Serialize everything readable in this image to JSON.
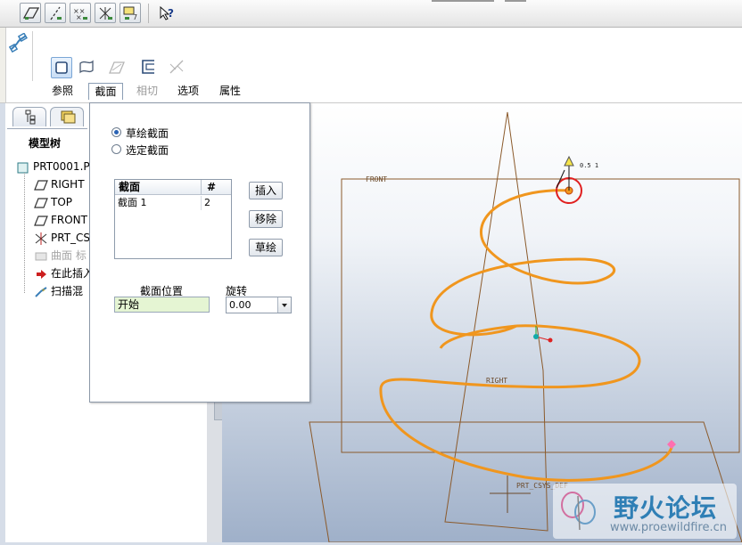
{
  "toolbar": {
    "icons": [
      "datum-plane-display-icon",
      "datum-axis-display-icon",
      "datum-point-display-icon",
      "coordinate-system-display-icon",
      "annotation-display-icon",
      "context-help-icon"
    ]
  },
  "dashboard": {
    "tabs": [
      {
        "label": "参照",
        "state": "normal"
      },
      {
        "label": "截面",
        "state": "active"
      },
      {
        "label": "相切",
        "state": "disabled"
      },
      {
        "label": "选项",
        "state": "normal"
      },
      {
        "label": "属性",
        "state": "normal"
      }
    ]
  },
  "model_tree": {
    "title": "模型树",
    "items": [
      {
        "label": "PRT0001.P",
        "icon": "part-icon",
        "state": "normal"
      },
      {
        "label": "RIGHT",
        "icon": "datum-plane-icon",
        "state": "normal"
      },
      {
        "label": "TOP",
        "icon": "datum-plane-icon",
        "state": "normal"
      },
      {
        "label": "FRONT",
        "icon": "datum-plane-icon",
        "state": "normal"
      },
      {
        "label": "PRT_CS",
        "icon": "coordinate-system-icon",
        "state": "normal"
      },
      {
        "label": "曲面 标",
        "icon": "surface-icon",
        "state": "greyed"
      },
      {
        "label": "在此插入",
        "icon": "insert-here-arrow-icon",
        "state": "normal"
      },
      {
        "label": "扫描混",
        "icon": "swept-blend-icon",
        "state": "normal"
      }
    ]
  },
  "sections_panel": {
    "radio_sketched": "草绘截面",
    "radio_selected": "选定截面",
    "selected": "sketched",
    "table_headers": [
      "截面",
      "#"
    ],
    "rows": [
      {
        "name": "截面 1",
        "count": "2"
      }
    ],
    "insert_button": "插入",
    "remove_button": "移除",
    "sketch_button": "草绘",
    "position_label": "截面位置",
    "position_value": "开始",
    "rotation_label": "旋转",
    "rotation_value": "0.00"
  },
  "graphics": {
    "labels": {
      "front": "FRONT",
      "right": "RIGHT",
      "top_partial": "PRT_CSYS_DEF",
      "dimension": "0.5 1"
    },
    "colors": {
      "helix": "#f0961e",
      "datum": "#8b5a2b",
      "selection": "#e02020",
      "background_bottom": "#9fb0c9"
    }
  },
  "watermark": {
    "title": "野火论坛",
    "url": "www.proewildfire.cn"
  }
}
